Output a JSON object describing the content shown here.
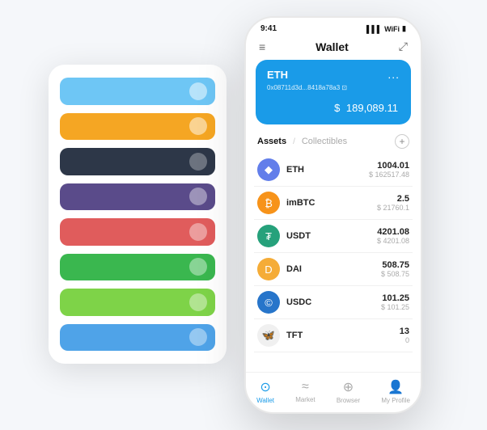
{
  "bg_card": {
    "rows": [
      {
        "color": "#6ec6f5",
        "dot_color": "rgba(255,255,255,0.5)"
      },
      {
        "color": "#f5a623",
        "dot_color": "rgba(255,255,255,0.5)"
      },
      {
        "color": "#2d3748",
        "dot_color": "rgba(255,255,255,0.3)"
      },
      {
        "color": "#5a4b8a",
        "dot_color": "rgba(255,255,255,0.4)"
      },
      {
        "color": "#e05c5c",
        "dot_color": "rgba(255,255,255,0.4)"
      },
      {
        "color": "#3ab74f",
        "dot_color": "rgba(255,255,255,0.4)"
      },
      {
        "color": "#7ed348",
        "dot_color": "rgba(255,255,255,0.4)"
      },
      {
        "color": "#4fa3e8",
        "dot_color": "rgba(255,255,255,0.4)"
      }
    ]
  },
  "status_bar": {
    "time": "9:41",
    "signal": "▌▌▌",
    "wifi": "WiFi",
    "battery": "🔋"
  },
  "header": {
    "menu_icon": "≡",
    "title": "Wallet",
    "expand_icon": "⤢"
  },
  "eth_card": {
    "name": "ETH",
    "dots": "...",
    "address": "0x08711d3d...8418a78a3",
    "copy_icon": "⊡",
    "balance_symbol": "$",
    "balance": "189,089.11"
  },
  "assets": {
    "tab_active": "Assets",
    "divider": "/",
    "tab_inactive": "Collectibles",
    "add_icon": "+",
    "items": [
      {
        "symbol": "ETH",
        "name": "ETH",
        "icon": "◆",
        "icon_class": "eth-bg",
        "amount": "1004.01",
        "usd": "$ 162517.48"
      },
      {
        "symbol": "imBTC",
        "name": "imBTC",
        "icon": "₿",
        "icon_class": "imbtc-bg",
        "amount": "2.5",
        "usd": "$ 21760.1"
      },
      {
        "symbol": "USDT",
        "name": "USDT",
        "icon": "₮",
        "icon_class": "usdt-bg",
        "amount": "4201.08",
        "usd": "$ 4201.08"
      },
      {
        "symbol": "DAI",
        "name": "DAI",
        "icon": "◉",
        "icon_class": "dai-bg",
        "amount": "508.75",
        "usd": "$ 508.75"
      },
      {
        "symbol": "USDC",
        "name": "USDC",
        "icon": "©",
        "icon_class": "usdc-bg",
        "amount": "101.25",
        "usd": "$ 101.25"
      },
      {
        "symbol": "TFT",
        "name": "TFT",
        "icon": "🦋",
        "icon_class": "tft-bg",
        "amount": "13",
        "usd": "0"
      }
    ]
  },
  "bottom_nav": [
    {
      "label": "Wallet",
      "icon": "⊙",
      "active": true
    },
    {
      "label": "Market",
      "icon": "📊",
      "active": false
    },
    {
      "label": "Browser",
      "icon": "🌐",
      "active": false
    },
    {
      "label": "My Profile",
      "icon": "👤",
      "active": false
    }
  ]
}
